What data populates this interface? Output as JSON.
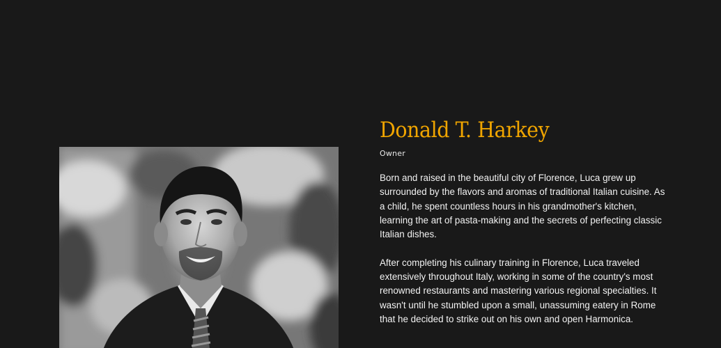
{
  "profile": {
    "name": "Donald T. Harkey",
    "role": "Owner",
    "bio": [
      "Born and raised in the beautiful city of Florence, Luca grew up surrounded by the flavors and aromas of traditional Italian cuisine. As a child, he spent countless hours in his grandmother's kitchen, learning the art of pasta-making and the secrets of perfecting classic Italian dishes.",
      "After completing his culinary training in Florence, Luca traveled extensively throughout Italy, working in some of the country's most renowned restaurants and mastering various regional specialties. It wasn't until he stumbled upon a small, unassuming eatery in Rome that he decided to strike out on his own and open Harmonica."
    ]
  },
  "colors": {
    "background": "#191919",
    "accent": "#f0a500",
    "text": "#f2f2f2"
  }
}
